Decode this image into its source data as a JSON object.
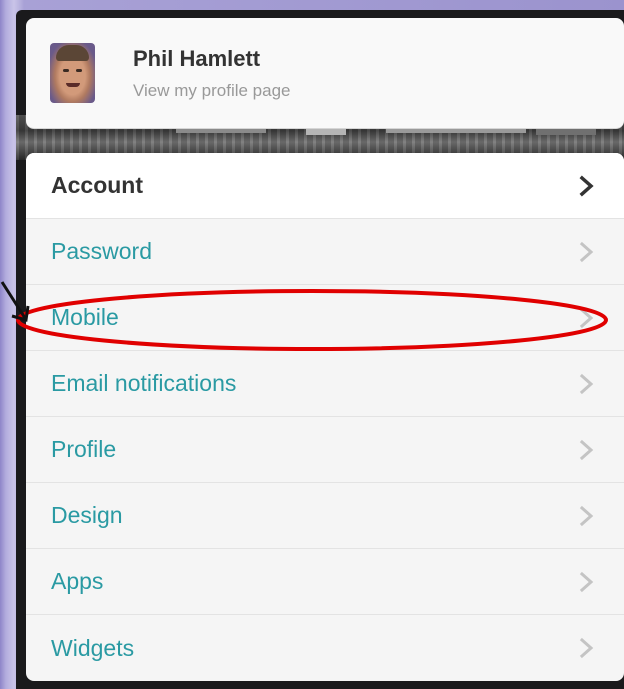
{
  "profile": {
    "name": "Phil Hamlett",
    "subtext": "View my profile page"
  },
  "menu": {
    "header": "Account",
    "items": [
      {
        "label": "Password"
      },
      {
        "label": "Mobile"
      },
      {
        "label": "Email notifications"
      },
      {
        "label": "Profile"
      },
      {
        "label": "Design"
      },
      {
        "label": "Apps"
      },
      {
        "label": "Widgets"
      }
    ]
  },
  "colors": {
    "link": "#2a9aa3",
    "header_text": "#333333",
    "annotation": "#e00000",
    "frame": "#9b93ce"
  },
  "icons": {
    "menu_chevron": "chevron-right-icon"
  }
}
